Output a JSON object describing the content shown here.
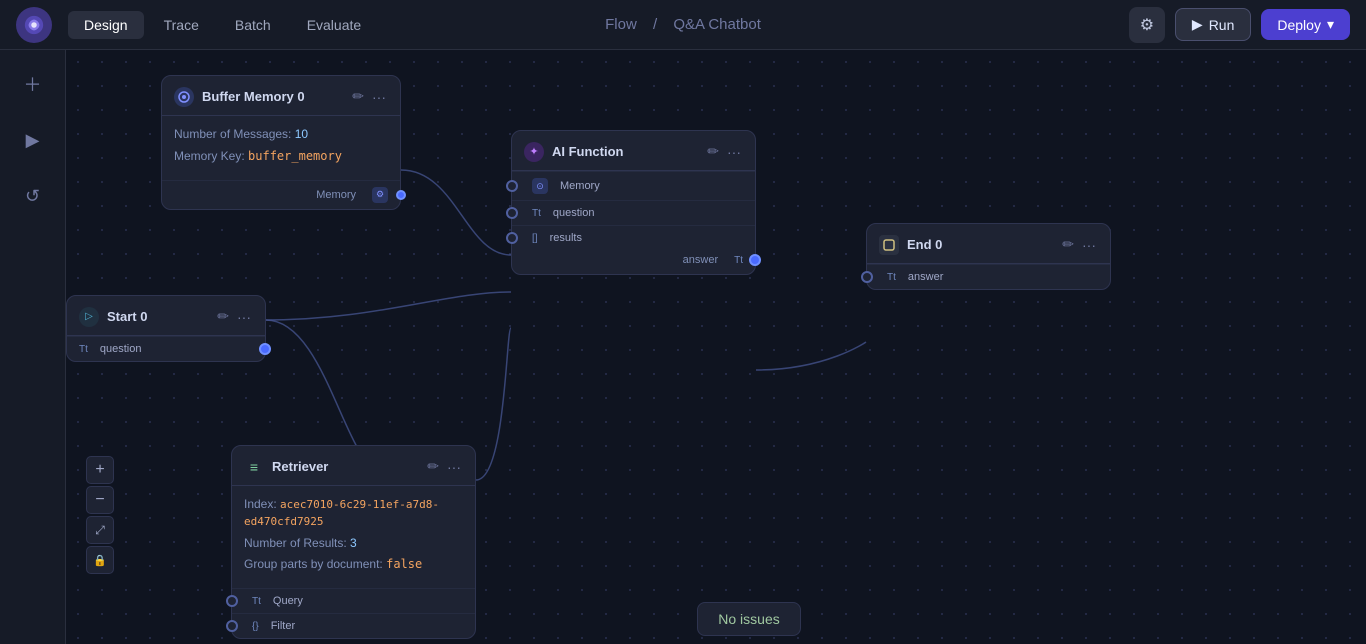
{
  "nav": {
    "logo_label": "logo",
    "tabs": [
      "Design",
      "Trace",
      "Batch",
      "Evaluate"
    ],
    "active_tab": "Design",
    "breadcrumb_flow": "Flow",
    "breadcrumb_sep": "/",
    "breadcrumb_page": "Q&A Chatbot",
    "settings_label": "⚙",
    "run_label": "Run",
    "deploy_label": "Deploy"
  },
  "sidebar": {
    "buttons": [
      {
        "name": "add",
        "icon": "+"
      },
      {
        "name": "play",
        "icon": "▶"
      },
      {
        "name": "history",
        "icon": "↺"
      }
    ]
  },
  "nodes": {
    "buffer_memory": {
      "title": "Buffer Memory 0",
      "icon": "M",
      "props": {
        "num_messages_label": "Number of Messages:",
        "num_messages_val": "10",
        "memory_key_label": "Memory Key:",
        "memory_key_val": "buffer_memory"
      },
      "port_label": "Memory"
    },
    "start": {
      "title": "Start 0",
      "port_label": "question"
    },
    "ai_function": {
      "title": "AI Function",
      "icon": "✦",
      "ports": [
        {
          "label": "Memory",
          "icon": "M",
          "type": "memory"
        },
        {
          "label": "question",
          "icon": "Tt"
        },
        {
          "label": "results",
          "icon": "[]"
        }
      ],
      "port_right_label": "answer"
    },
    "end": {
      "title": "End 0",
      "icon": "E",
      "port_label": "answer"
    },
    "retriever": {
      "title": "Retriever",
      "icon": "≡",
      "props": {
        "index_label": "Index:",
        "index_val": "acec7010-6c29-11ef-a7d8-ed470cfd7925",
        "num_results_label": "Number of Results:",
        "num_results_val": "3",
        "group_label": "Group parts by document:",
        "group_val": "false"
      },
      "ports": [
        {
          "label": "Query",
          "icon": "Tt"
        },
        {
          "label": "Filter",
          "icon": "{}"
        }
      ]
    }
  },
  "status": {
    "no_issues": "No issues"
  },
  "zoom": {
    "plus": "+",
    "minus": "−",
    "fit": "⤢",
    "lock": "🔒"
  }
}
